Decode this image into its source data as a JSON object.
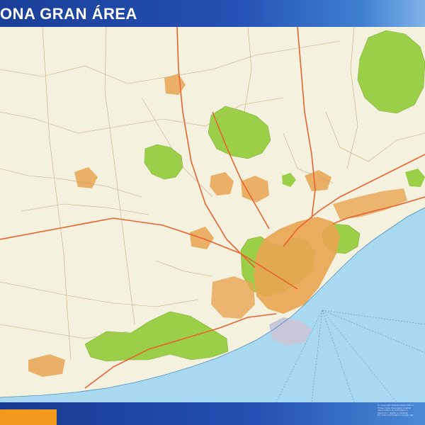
{
  "map": {
    "title": "ONA GRAN ÁREA",
    "colors": {
      "land": "#f4f1df",
      "sea": "#a9d8f1",
      "park": "#9ccf48",
      "urban": "#e9a552",
      "road_major": "#e8632f",
      "road_minor": "#c9a170",
      "header_blue": "#2450b3",
      "accent_orange": "#f39a1c"
    },
    "copyright_lines": [
      "© Copyright Globalmapsit 1997-2",
      "These maps have been created",
      "reproduction is prohibited, o",
      "electronic, digital or mechan",
      "For more information consult: ww"
    ]
  }
}
